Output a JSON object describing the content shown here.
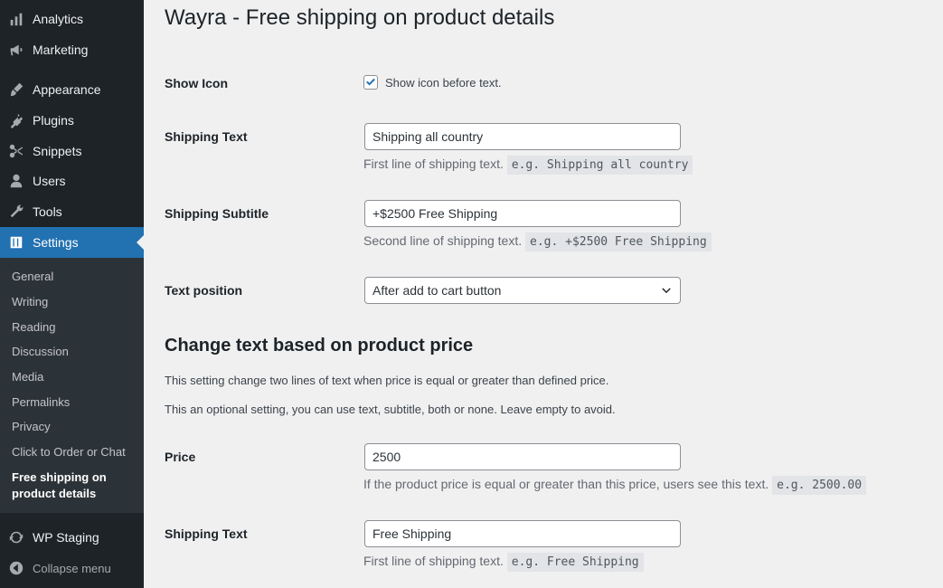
{
  "sidebar": {
    "items": [
      {
        "label": "Analytics",
        "icon": "bar-chart-icon"
      },
      {
        "label": "Marketing",
        "icon": "megaphone-icon"
      },
      {
        "label": "Appearance",
        "icon": "paintbrush-icon"
      },
      {
        "label": "Plugins",
        "icon": "plug-icon"
      },
      {
        "label": "Snippets",
        "icon": "scissors-icon"
      },
      {
        "label": "Users",
        "icon": "user-icon"
      },
      {
        "label": "Tools",
        "icon": "wrench-icon"
      },
      {
        "label": "Settings",
        "icon": "sliders-icon"
      }
    ],
    "submenu": [
      "General",
      "Writing",
      "Reading",
      "Discussion",
      "Media",
      "Permalinks",
      "Privacy",
      "Click to Order or Chat",
      "Free shipping on product details"
    ],
    "wp_staging": "WP Staging",
    "collapse": "Collapse menu",
    "accent": "#2271b1"
  },
  "page": {
    "title": "Wayra - Free shipping on product details",
    "show_icon": {
      "label": "Show Icon",
      "checkbox_text": "Show icon before text.",
      "checked": true
    },
    "shipping_text": {
      "label": "Shipping Text",
      "value": "Shipping all country",
      "desc": "First line of shipping text.",
      "example": "e.g. Shipping all country"
    },
    "shipping_subtitle": {
      "label": "Shipping Subtitle",
      "value": "+$2500 Free Shipping",
      "desc": "Second line of shipping text.",
      "example": "e.g. +$2500 Free Shipping"
    },
    "text_position": {
      "label": "Text position",
      "value": "After add to cart button"
    },
    "section_title": "Change text based on product price",
    "para1": "This setting change two lines of text when price is equal or greater than defined price.",
    "para2": "This an optional setting, you can use text, subtitle, both or none. Leave empty to avoid.",
    "price": {
      "label": "Price",
      "value": "2500",
      "desc": "If the product price is equal or greater than this price, users see this text.",
      "example": "e.g. 2500.00"
    },
    "shipping_text2": {
      "label": "Shipping Text",
      "value": "Free Shipping",
      "desc": "First line of shipping text.",
      "example": "e.g. Free Shipping"
    }
  }
}
